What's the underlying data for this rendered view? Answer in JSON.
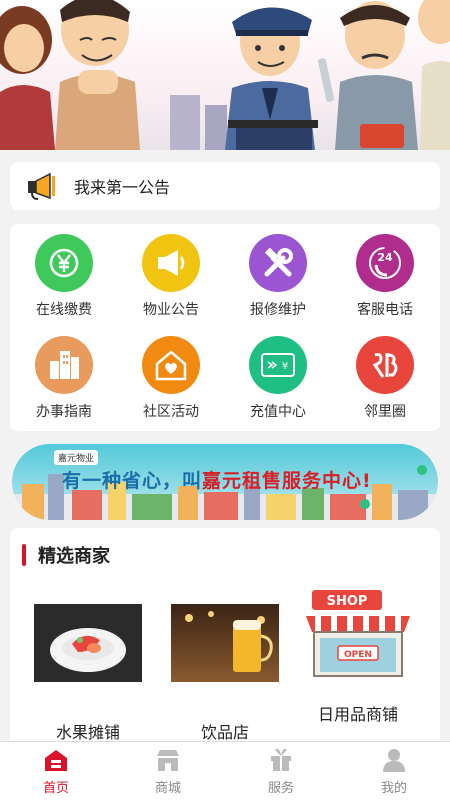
{
  "notice": {
    "text": "我来第一公告"
  },
  "services": [
    {
      "label": "在线缴费",
      "icon": "yen-payment-icon",
      "color": "#3ec95a"
    },
    {
      "label": "物业公告",
      "icon": "megaphone-icon",
      "color": "#f2c412"
    },
    {
      "label": "报修维护",
      "icon": "wrench-hammer-icon",
      "color": "#9b55d3"
    },
    {
      "label": "客服电话",
      "icon": "phone-24h-icon",
      "color": "#b02d8e"
    },
    {
      "label": "办事指南",
      "icon": "buildings-icon",
      "color": "#e89b5c"
    },
    {
      "label": "社区活动",
      "icon": "house-heart-icon",
      "color": "#f28a12"
    },
    {
      "label": "充值中心",
      "icon": "recharge-card-icon",
      "color": "#1fbf83"
    },
    {
      "label": "邻里圈",
      "icon": "neighbor-icon",
      "color": "#e8453c"
    }
  ],
  "ad": {
    "brand": "嘉元物业",
    "slogan_prefix": "有一种省心，叫",
    "slogan_highlight": "嘉元租售服务中心!"
  },
  "merchants": {
    "title": "精选商家",
    "items": [
      {
        "name": "水果摊铺"
      },
      {
        "name": "饮品店"
      },
      {
        "name": "日用品商铺"
      }
    ],
    "shop_sign": "SHOP",
    "open_sign": "OPEN"
  },
  "tabs": [
    {
      "label": "首页",
      "icon": "home-icon",
      "active": true
    },
    {
      "label": "商城",
      "icon": "store-icon",
      "active": false
    },
    {
      "label": "服务",
      "icon": "gift-icon",
      "active": false
    },
    {
      "label": "我的",
      "icon": "user-icon",
      "active": false
    }
  ],
  "colors": {
    "accent": "#d8132b",
    "background": "#f2f2f2"
  }
}
